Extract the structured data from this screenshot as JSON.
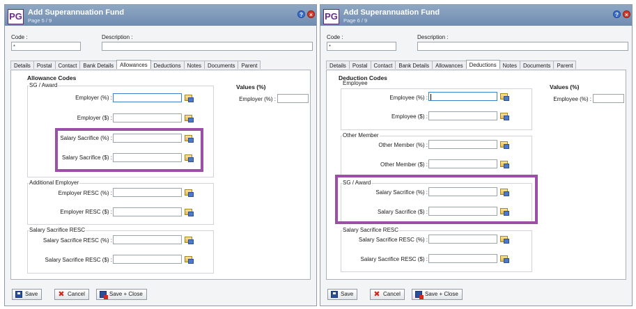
{
  "left": {
    "title": "Add Superannuation Fund",
    "page": "Page 5 / 9",
    "logo": "PG",
    "code_label": "Code :",
    "code_value": "*",
    "description_label": "Description :",
    "tabs": [
      "Details",
      "Postal",
      "Contact",
      "Bank Details",
      "Allowances",
      "Deductions",
      "Notes",
      "Documents",
      "Parent"
    ],
    "active_tab": "Allowances",
    "section_title": "Allowance Codes",
    "groups": [
      {
        "title": "SG / Award",
        "fields": [
          "Employer (%) :",
          "Employer ($) :",
          "Salary Sacrifice (%) :",
          "Salary Sacrifice ($) :"
        ]
      },
      {
        "title": "Additional Employer",
        "fields": [
          "Employer RESC (%) :",
          "Employer RESC ($) :"
        ]
      },
      {
        "title": "Salary Sacrifice RESC",
        "fields": [
          "Salary Sacrifice RESC (%) :",
          "Salary Sacrifice RESC ($) :"
        ]
      }
    ],
    "values_title": "Values (%)",
    "values_field": "Employer (%) :"
  },
  "right": {
    "title": "Add Superannuation Fund",
    "page": "Page 6 / 9",
    "logo": "PG",
    "code_label": "Code :",
    "code_value": "*",
    "description_label": "Description :",
    "tabs": [
      "Details",
      "Postal",
      "Contact",
      "Bank Details",
      "Allowances",
      "Deductions",
      "Notes",
      "Documents",
      "Parent"
    ],
    "active_tab": "Deductions",
    "section_title": "Deduction Codes",
    "groups": [
      {
        "title": "Employee",
        "fields": [
          "Employee (%) :",
          "Employee ($) :"
        ]
      },
      {
        "title": "Other Member",
        "fields": [
          "Other Member (%) :",
          "Other Member ($) :"
        ]
      },
      {
        "title": "SG / Award",
        "fields": [
          "Salary Sacrifice (%) :",
          "Salary Sacrifice ($) :"
        ]
      },
      {
        "title": "Salary Sacrifice RESC",
        "fields": [
          "Salary Sacrifice RESC (%) :",
          "Salary Sacrifice RESC ($) :"
        ]
      }
    ],
    "values_title": "Values (%)",
    "values_field": "Employee (%) :"
  },
  "buttons": {
    "save": "Save",
    "cancel": "Cancel",
    "save_close": "Save + Close"
  },
  "icons": {
    "help": "help-icon",
    "close": "close-icon",
    "lookup": "lookup-icon"
  },
  "colors": {
    "titlebar": "#7b96b8",
    "highlight": "#9b4fa5",
    "logo": "#6b2b8f"
  }
}
